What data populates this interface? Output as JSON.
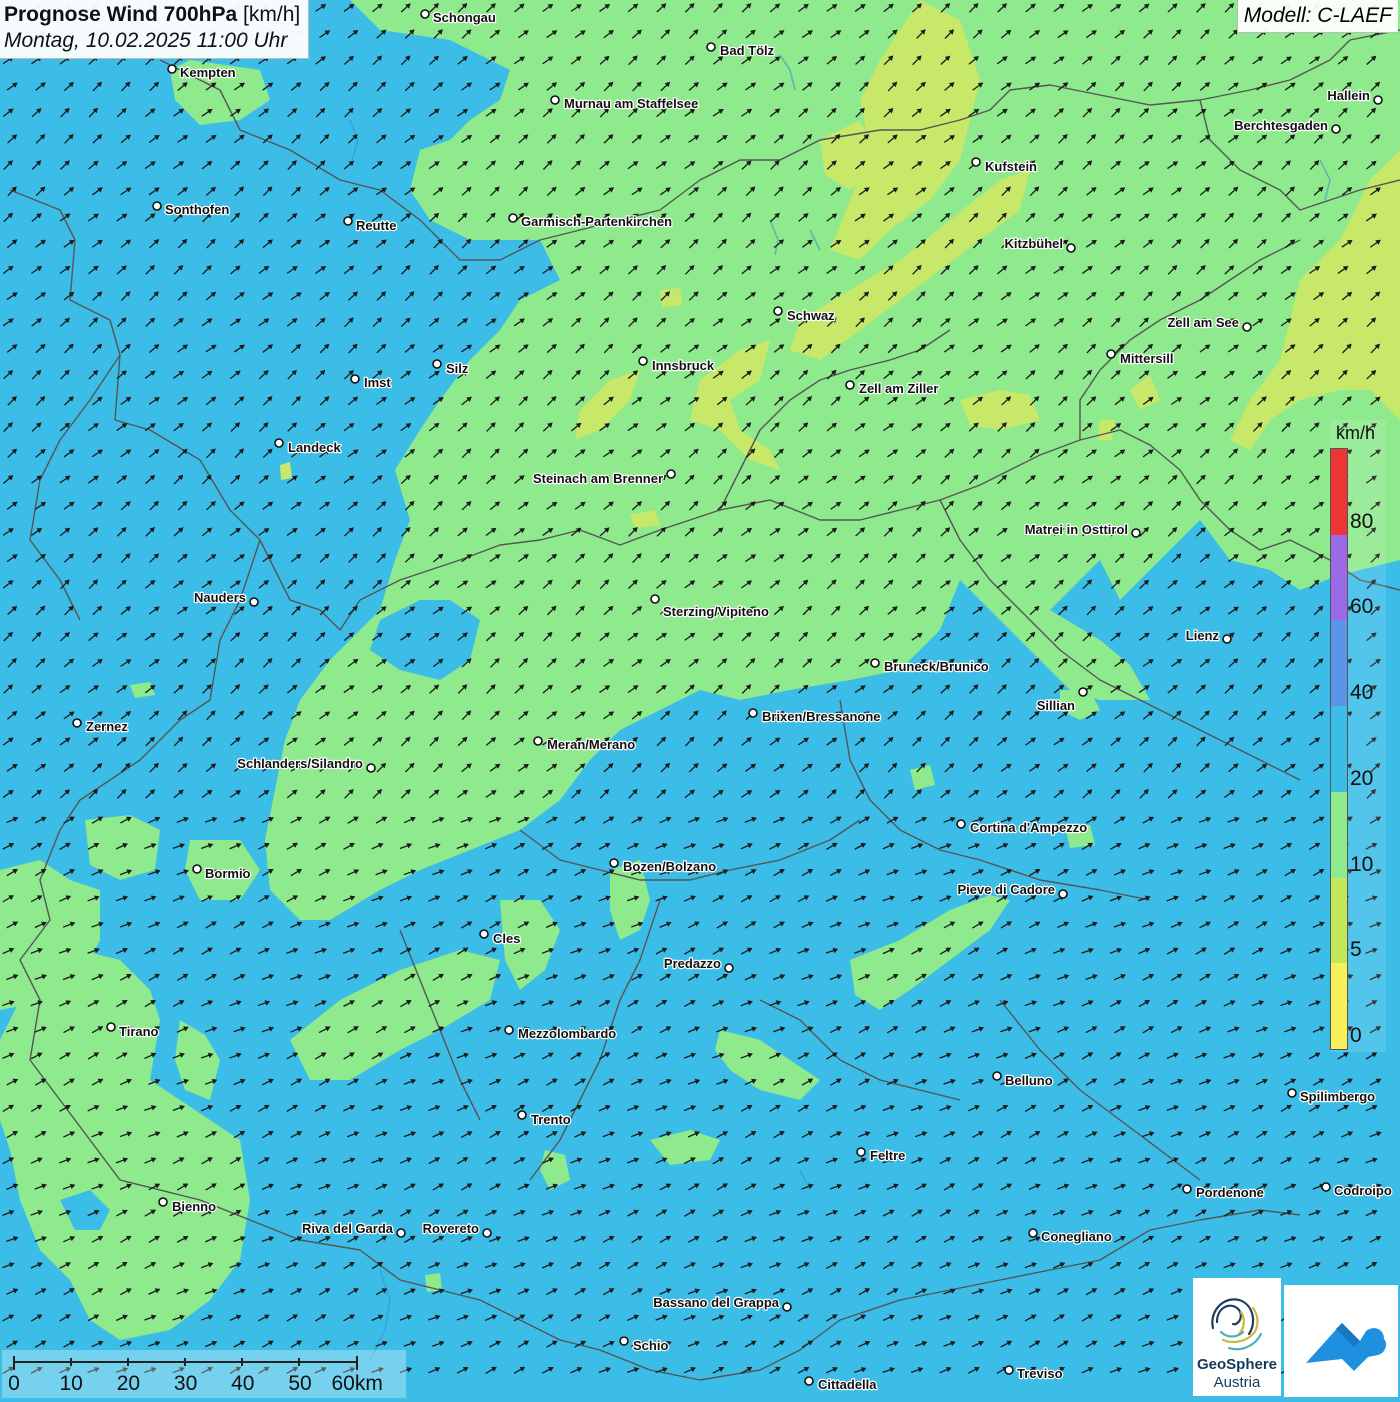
{
  "title": {
    "main_bold": "Prognose Wind 700hPa",
    "main_unit": "[km/h]",
    "datetime": "Montag, 10.02.2025 11:00 Uhr"
  },
  "model": "Modell: C-LAEF",
  "legend": {
    "unit": "km/h",
    "ticks": [
      "0",
      "5",
      "10",
      "20",
      "40",
      "60",
      "80"
    ],
    "colors": [
      "#f7f25b",
      "#c3e85a",
      "#8eea8c",
      "#3cbde8",
      "#5b95ea",
      "#9b6ae6",
      "#ee3434"
    ]
  },
  "scalebar": {
    "labels": [
      "0",
      "10",
      "20",
      "30",
      "40",
      "50",
      "60km"
    ]
  },
  "logo": {
    "line1": "GeoSphere",
    "line2": "Austria"
  },
  "colors": {
    "sea_blue": "#3cbde8",
    "green": "#8eea8c",
    "yellow_green": "#c8e86a",
    "border": "#555555"
  },
  "wind_direction": "southwest to northeast",
  "cities": [
    {
      "name": "Schongau",
      "icon": "city-marker-icon"
    },
    {
      "name": "Bad Tölz",
      "icon": "city-marker-icon"
    },
    {
      "name": "Kempten",
      "icon": "city-marker-icon"
    },
    {
      "name": "Murnau am Staffelsee",
      "icon": "city-marker-icon"
    },
    {
      "name": "Hallein",
      "icon": "city-marker-icon"
    },
    {
      "name": "Berchtesgaden",
      "icon": "city-marker-icon"
    },
    {
      "name": "Kufstein",
      "icon": "city-marker-icon"
    },
    {
      "name": "Sonthofen",
      "icon": "city-marker-icon"
    },
    {
      "name": "Reutte",
      "icon": "city-marker-icon"
    },
    {
      "name": "Garmisch-Partenkirchen",
      "icon": "city-marker-icon"
    },
    {
      "name": "Kitzbühel",
      "icon": "city-marker-icon"
    },
    {
      "name": "Schwaz",
      "icon": "city-marker-icon"
    },
    {
      "name": "Zell am See",
      "icon": "city-marker-icon"
    },
    {
      "name": "Mittersill",
      "icon": "city-marker-icon"
    },
    {
      "name": "Innsbruck",
      "icon": "city-marker-icon"
    },
    {
      "name": "Silz",
      "icon": "city-marker-icon"
    },
    {
      "name": "Imst",
      "icon": "city-marker-icon"
    },
    {
      "name": "Zell am Ziller",
      "icon": "city-marker-icon"
    },
    {
      "name": "Landeck",
      "icon": "city-marker-icon"
    },
    {
      "name": "Steinach am Brenner",
      "icon": "city-marker-icon"
    },
    {
      "name": "Matrei in Osttirol",
      "icon": "city-marker-icon"
    },
    {
      "name": "Nauders",
      "icon": "city-marker-icon"
    },
    {
      "name": "Sterzing/Vipiteno",
      "icon": "city-marker-icon"
    },
    {
      "name": "Lienz",
      "icon": "city-marker-icon"
    },
    {
      "name": "Bruneck/Brunico",
      "icon": "city-marker-icon"
    },
    {
      "name": "Sillian",
      "icon": "city-marker-icon"
    },
    {
      "name": "Brixen/Bressanone",
      "icon": "city-marker-icon"
    },
    {
      "name": "Zernez",
      "icon": "city-marker-icon"
    },
    {
      "name": "Meran/Merano",
      "icon": "city-marker-icon"
    },
    {
      "name": "Schlanders/Silandro",
      "icon": "city-marker-icon"
    },
    {
      "name": "Cortina d'Ampezzo",
      "icon": "city-marker-icon"
    },
    {
      "name": "Bozen/Bolzano",
      "icon": "city-marker-icon"
    },
    {
      "name": "Bormio",
      "icon": "city-marker-icon"
    },
    {
      "name": "Pieve di Cadore",
      "icon": "city-marker-icon"
    },
    {
      "name": "Cles",
      "icon": "city-marker-icon"
    },
    {
      "name": "Predazzo",
      "icon": "city-marker-icon"
    },
    {
      "name": "Tirano",
      "icon": "city-marker-icon"
    },
    {
      "name": "Mezzolombardo",
      "icon": "city-marker-icon"
    },
    {
      "name": "Belluno",
      "icon": "city-marker-icon"
    },
    {
      "name": "Spilimbergo",
      "icon": "city-marker-icon"
    },
    {
      "name": "Trento",
      "icon": "city-marker-icon"
    },
    {
      "name": "Feltre",
      "icon": "city-marker-icon"
    },
    {
      "name": "Pordenone",
      "icon": "city-marker-icon"
    },
    {
      "name": "Codroipo",
      "icon": "city-marker-icon"
    },
    {
      "name": "Bienno",
      "icon": "city-marker-icon"
    },
    {
      "name": "Riva del Garda",
      "icon": "city-marker-icon"
    },
    {
      "name": "Rovereto",
      "icon": "city-marker-icon"
    },
    {
      "name": "Conegliano",
      "icon": "city-marker-icon"
    },
    {
      "name": "Bassano del Grappa",
      "icon": "city-marker-icon"
    },
    {
      "name": "Schio",
      "icon": "city-marker-icon"
    },
    {
      "name": "Treviso",
      "icon": "city-marker-icon"
    },
    {
      "name": "Cittadella",
      "icon": "city-marker-icon"
    }
  ]
}
